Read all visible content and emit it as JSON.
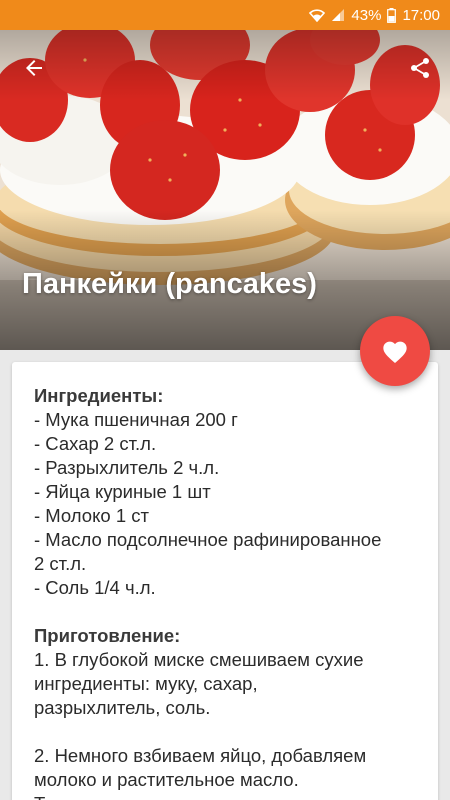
{
  "status_bar": {
    "battery": "43%",
    "time": "17:00",
    "icons": [
      "wifi-icon",
      "signal-icon",
      "battery-icon"
    ]
  },
  "header": {
    "back_icon": "arrow-left-icon",
    "share_icon": "share-icon",
    "title": "Панкейки (pancakes)"
  },
  "fab": {
    "icon": "heart-icon",
    "color": "#ef4a43"
  },
  "recipe": {
    "ingredients_title": "Ингредиенты:",
    "ingredients": [
      "- Мука пшеничная 200 г",
      "- Сахар 2 ст.л.",
      "- Разрыхлитель 2 ч.л.",
      "- Яйца куриные 1 шт",
      "- Молоко 1 ст",
      "- Масло подсолнечное рафинированное",
      "2 ст.л.",
      "- Соль 1/4 ч.л."
    ],
    "preparation_title": "Приготовление:",
    "step1": [
      "1. В глубокой миске смешиваем сухие",
      "ингредиенты: муку, сахар,",
      "разрыхлитель, соль."
    ],
    "step2": [
      "2. Немного взбиваем яйцо, добавляем",
      "молоко и растительное масло.",
      "Тщательно все перемешиваем."
    ]
  },
  "colors": {
    "accent": "#f08a1a",
    "fab": "#ef4a43",
    "background": "#e9e9e9"
  }
}
